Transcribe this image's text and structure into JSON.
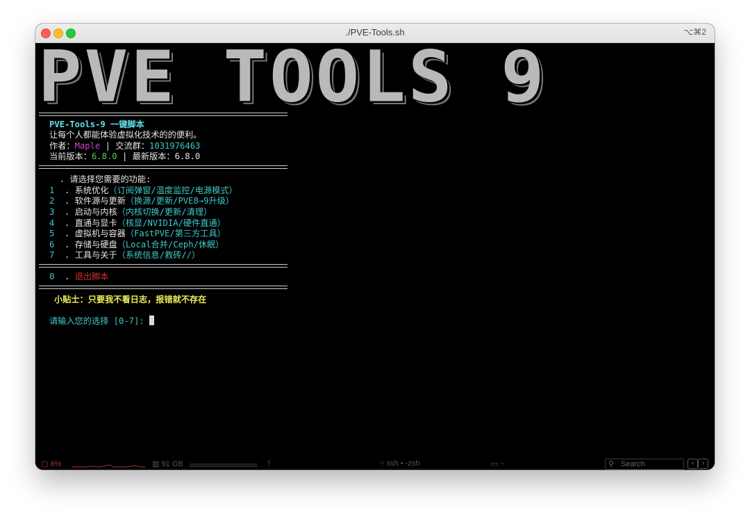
{
  "window": {
    "title": "./PVE-Tools.sh",
    "shortcut": "⌥⌘2"
  },
  "banner": {
    "text": "PVE TOOLS 9"
  },
  "header": {
    "name": "PVE-Tools-9 一键脚本",
    "tagline": "让每个人都能体验虚拟化技术的的便利。",
    "author_label": "作者：",
    "author": "Maple",
    "separator": " | ",
    "group_label": "交流群：",
    "group": "1031976463",
    "current_label": "当前版本：",
    "current_version": "6.8.0",
    "latest_label": "最新版本：",
    "latest_version": "6.8.0"
  },
  "menu": {
    "prompt": "  . 请选择您需要的功能:",
    "items": [
      {
        "num": "1",
        "label": "系统优化",
        "desc": "（订阅弹窗/温度监控/电源模式）"
      },
      {
        "num": "2",
        "label": "软件源与更新",
        "desc": "（换源/更新/PVE8→9升级）"
      },
      {
        "num": "3",
        "label": "启动与内核",
        "desc": "（内核切换/更新/清理）"
      },
      {
        "num": "4",
        "label": "直通与显卡",
        "desc": "（核显/NVIDIA/硬件直通）"
      },
      {
        "num": "5",
        "label": "虚拟机与容器",
        "desc": "（FastPVE/第三方工具）"
      },
      {
        "num": "6",
        "label": "存储与硬盘",
        "desc": "（Local合并/Ceph/休眠）"
      },
      {
        "num": "7",
        "label": "工具与关于",
        "desc": "（系统信息/救砖//）"
      }
    ],
    "exit": {
      "num": "0",
      "label": "退出脚本"
    }
  },
  "tip": "小贴士：只要我不看日志，报错就不存在",
  "input_prompt": "请输入您的选择 [0-7]: ",
  "statusbar": {
    "cpu": "6%",
    "memory": "91 GB",
    "session": "ssh • -zsh",
    "dir": "~",
    "search_placeholder": "Search",
    "colors": {
      "cpu": "#aa3333",
      "text": "#555555"
    }
  }
}
